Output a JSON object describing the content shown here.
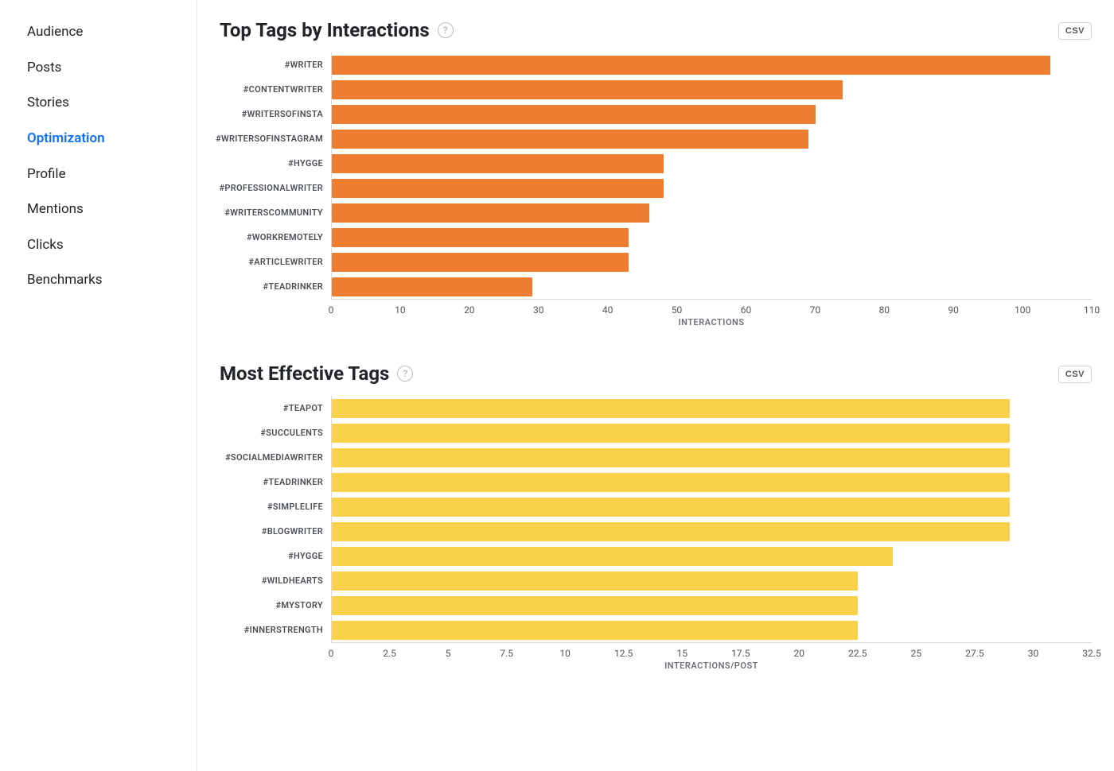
{
  "sidebar": {
    "items": [
      {
        "label": "Audience"
      },
      {
        "label": "Posts"
      },
      {
        "label": "Stories"
      },
      {
        "label": "Optimization",
        "active": true
      },
      {
        "label": "Profile"
      },
      {
        "label": "Mentions"
      },
      {
        "label": "Clicks"
      },
      {
        "label": "Benchmarks"
      }
    ]
  },
  "csv_label": "CSV",
  "panels": [
    {
      "title": "Top Tags by Interactions",
      "color": "orange"
    },
    {
      "title": "Most Effective Tags",
      "color": "yellow"
    }
  ],
  "chart_data": [
    {
      "type": "bar",
      "orientation": "horizontal",
      "title": "Top Tags by Interactions",
      "xlabel": "INTERACTIONS",
      "ylabel": "",
      "xlim": [
        0,
        110
      ],
      "ticks": [
        0,
        10,
        20,
        30,
        40,
        50,
        60,
        70,
        80,
        90,
        100,
        110
      ],
      "categories": [
        "#WRITER",
        "#CONTENTWRITER",
        "#WRITERSOFINSTA",
        "#WRITERSOFINSTAGRAM",
        "#HYGGE",
        "#PROFESSIONALWRITER",
        "#WRITERSCOMMUNITY",
        "#WORKREMOTELY",
        "#ARTICLEWRITER",
        "#TEADRINKER"
      ],
      "values": [
        104,
        74,
        70,
        69,
        48,
        48,
        46,
        43,
        43,
        29
      ]
    },
    {
      "type": "bar",
      "orientation": "horizontal",
      "title": "Most Effective Tags",
      "xlabel": "INTERACTIONS/POST",
      "ylabel": "",
      "xlim": [
        0,
        32.5
      ],
      "ticks": [
        0,
        2.5,
        5,
        7.5,
        10,
        12.5,
        15,
        17.5,
        20,
        22.5,
        25,
        27.5,
        30,
        32.5
      ],
      "categories": [
        "#TEAPOT",
        "#SUCCULENTS",
        "#SOCIALMEDIAWRITER",
        "#TEADRINKER",
        "#SIMPLELIFE",
        "#BLOGWRITER",
        "#HYGGE",
        "#WILDHEARTS",
        "#MYSTORY",
        "#INNERSTRENGTH"
      ],
      "values": [
        29,
        29,
        29,
        29,
        29,
        29,
        24,
        22.5,
        22.5,
        22.5
      ]
    }
  ]
}
